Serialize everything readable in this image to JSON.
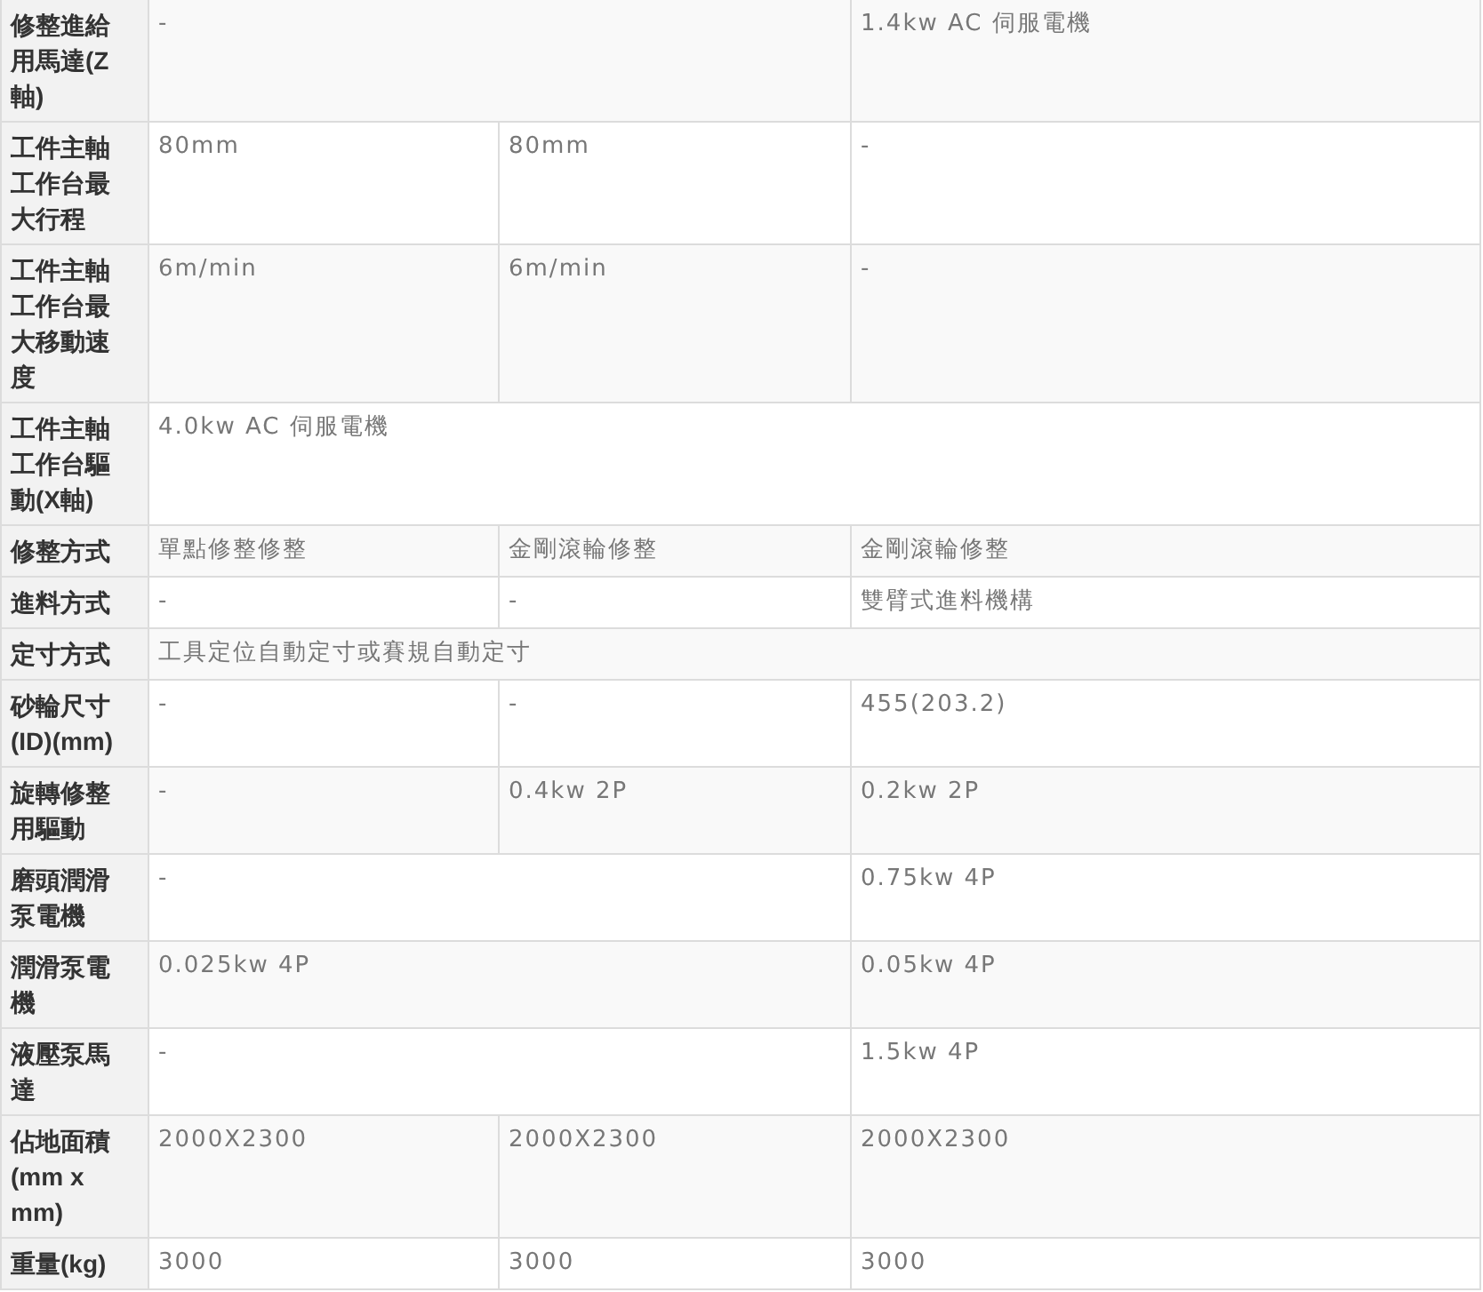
{
  "table": {
    "rows": [
      {
        "header": "修整進給用馬達(Z軸)",
        "cells": [
          {
            "text": "-",
            "colspan": 2
          },
          {
            "text": "1.4kw AC 伺服電機"
          }
        ]
      },
      {
        "header": "工件主軸工作台最大行程",
        "cells": [
          {
            "text": "80mm"
          },
          {
            "text": "80mm"
          },
          {
            "text": "-"
          }
        ]
      },
      {
        "header": "工件主軸工作台最大移動速度",
        "cells": [
          {
            "text": "6m/min"
          },
          {
            "text": "6m/min"
          },
          {
            "text": "-"
          }
        ]
      },
      {
        "header": "工件主軸工作台驅動(X軸)",
        "cells": [
          {
            "text": "4.0kw AC 伺服電機",
            "colspan": 3
          }
        ]
      },
      {
        "header": "修整方式",
        "cells": [
          {
            "text": "單點修整修整"
          },
          {
            "text": "金剛滾輪修整"
          },
          {
            "text": "金剛滾輪修整"
          }
        ]
      },
      {
        "header": "進料方式",
        "cells": [
          {
            "text": "-"
          },
          {
            "text": "-"
          },
          {
            "text": "雙臂式進料機構"
          }
        ]
      },
      {
        "header": "定寸方式",
        "cells": [
          {
            "text": "工具定位自動定寸或賽規自動定寸",
            "colspan": 3
          }
        ]
      },
      {
        "header": "砂輪尺寸(ID)(mm)",
        "cells": [
          {
            "text": "-"
          },
          {
            "text": "-"
          },
          {
            "text": "455(203.2)"
          }
        ]
      },
      {
        "header": "旋轉修整用驅動",
        "cells": [
          {
            "text": "-"
          },
          {
            "text": "0.4kw 2P"
          },
          {
            "text": "0.2kw 2P"
          }
        ]
      },
      {
        "header": "磨頭潤滑泵電機",
        "cells": [
          {
            "text": "-",
            "colspan": 2
          },
          {
            "text": "0.75kw 4P"
          }
        ]
      },
      {
        "header": "潤滑泵電機",
        "cells": [
          {
            "text": "0.025kw 4P",
            "colspan": 2
          },
          {
            "text": "0.05kw 4P"
          }
        ]
      },
      {
        "header": "液壓泵馬達",
        "cells": [
          {
            "text": "-",
            "colspan": 2
          },
          {
            "text": "1.5kw 4P"
          }
        ]
      },
      {
        "header": "佔地面積(mm x mm)",
        "cells": [
          {
            "text": "2000X2300"
          },
          {
            "text": "2000X2300"
          },
          {
            "text": "2000X2300"
          }
        ]
      },
      {
        "header": "重量(kg)",
        "cells": [
          {
            "text": "3000"
          },
          {
            "text": "3000"
          },
          {
            "text": "3000"
          }
        ]
      }
    ]
  }
}
